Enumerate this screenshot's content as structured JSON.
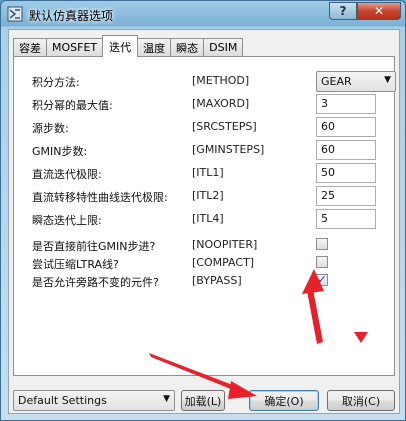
{
  "window": {
    "title": "默认仿真器选项",
    "help_label": "?",
    "close_label": "✕"
  },
  "tabs": [
    {
      "label": "容差"
    },
    {
      "label": "MOSFET"
    },
    {
      "label": "迭代"
    },
    {
      "label": "温度"
    },
    {
      "label": "瞬态"
    },
    {
      "label": "DSIM"
    }
  ],
  "rows": [
    {
      "label": "积分方法:",
      "key": "[METHOD]",
      "type": "select",
      "value": "GEAR"
    },
    {
      "label": "积分幂的最大值:",
      "key": "[MAXORD]",
      "type": "field",
      "value": "3"
    },
    {
      "label": "源步数:",
      "key": "[SRCSTEPS]",
      "type": "field",
      "value": "60"
    },
    {
      "label": "GMIN步数:",
      "key": "[GMINSTEPS]",
      "type": "field",
      "value": "60"
    },
    {
      "label": "直流迭代极限:",
      "key": "[ITL1]",
      "type": "field",
      "value": "50"
    },
    {
      "label": "直流转移特性曲线迭代极限:",
      "key": "[ITL2]",
      "type": "field",
      "value": "25"
    },
    {
      "label": "瞬态迭代上限:",
      "key": "[ITL4]",
      "type": "field",
      "value": "5"
    },
    {
      "label": "是否直接前往GMIN步进?",
      "key": "[NOOPITER]",
      "type": "checkbox",
      "checked": false
    },
    {
      "label": "尝试压缩LTRA线?",
      "key": "[COMPACT]",
      "type": "checkbox",
      "checked": false
    },
    {
      "label": "是否允许旁路不变的元件?",
      "key": "[BYPASS]",
      "type": "checkbox",
      "checked": true
    }
  ],
  "bottom": {
    "settings_value": "Default Settings",
    "load_label": "加载(L)",
    "ok_label": "确定(O)",
    "cancel_label": "取消(C)"
  },
  "check_mark": "✓",
  "dropdown_arrow": "▼",
  "colors": {
    "annotation_arrow": "#e8202a"
  }
}
